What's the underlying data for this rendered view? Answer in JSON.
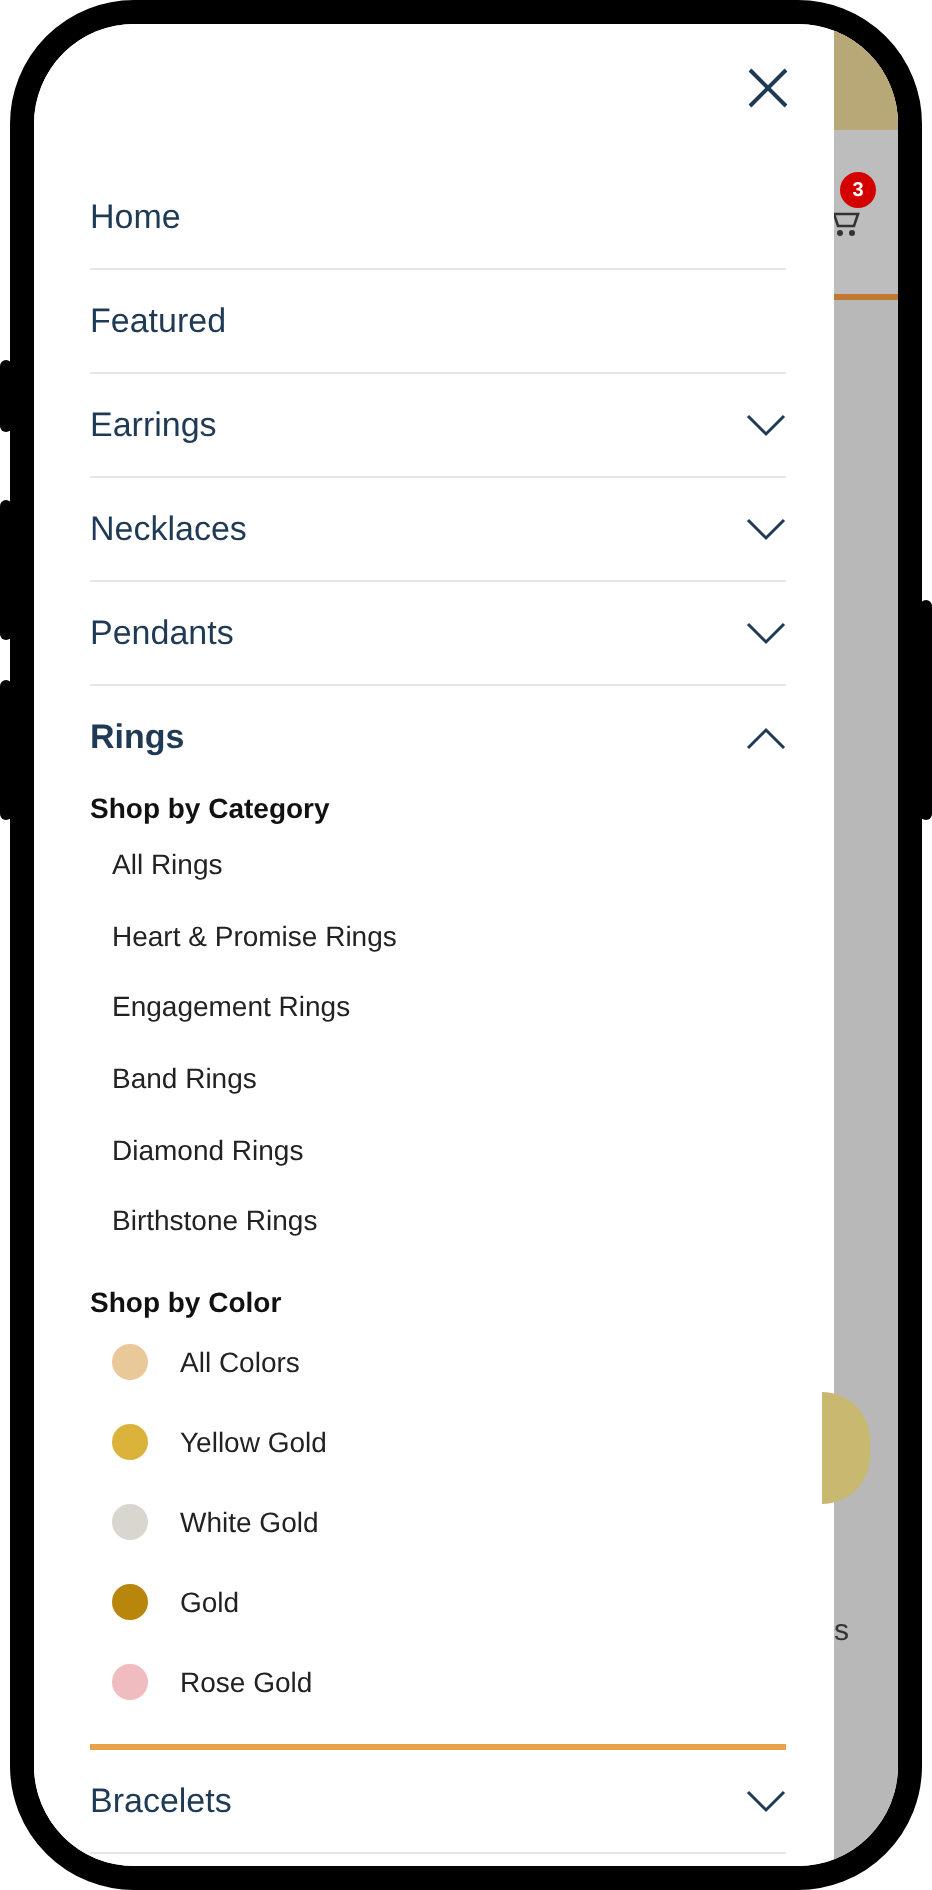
{
  "menu": [
    {
      "label": "Home",
      "kind": "link"
    },
    {
      "label": "Featured",
      "kind": "link"
    },
    {
      "label": "Earrings",
      "kind": "expandable",
      "expanded": false
    },
    {
      "label": "Necklaces",
      "kind": "expandable",
      "expanded": false
    },
    {
      "label": "Pendants",
      "kind": "expandable",
      "expanded": false
    },
    {
      "label": "Rings",
      "kind": "expandable",
      "expanded": true,
      "sections": [
        {
          "title": "Shop by Category",
          "kind": "list",
          "items": [
            {
              "label": "All Rings"
            },
            {
              "label": "Heart & Promise Rings"
            },
            {
              "label": "Engagement Rings"
            },
            {
              "label": "Band Rings"
            },
            {
              "label": "Diamond Rings"
            },
            {
              "label": "Birthstone Rings"
            }
          ]
        },
        {
          "title": "Shop by Color",
          "kind": "swatches",
          "items": [
            {
              "label": "All Colors",
              "color": "#e9c99a"
            },
            {
              "label": "Yellow Gold",
              "color": "#dcb33a"
            },
            {
              "label": "White Gold",
              "color": "#d9d6cf"
            },
            {
              "label": "Gold",
              "color": "#b8860b"
            },
            {
              "label": "Rose Gold",
              "color": "#f0bcc0"
            }
          ]
        }
      ]
    },
    {
      "label": "Bracelets",
      "kind": "expandable",
      "expanded": false
    }
  ],
  "background_page": {
    "cart_count": "3",
    "fragment_text": "s"
  }
}
